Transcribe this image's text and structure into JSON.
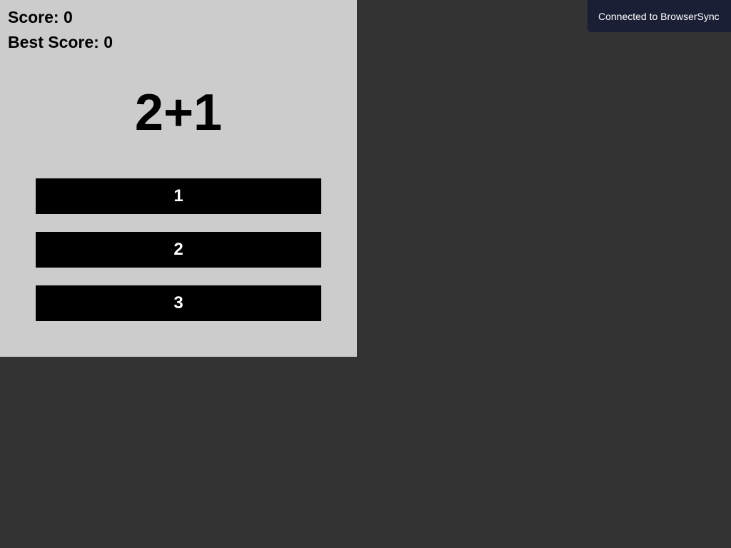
{
  "colors": {
    "page_background": "#333333",
    "panel_background": "#cccccc",
    "button_background": "#000000",
    "button_text": "#ffffff",
    "toast_background": "#1b1f36"
  },
  "game": {
    "score_label": "Score: 0",
    "best_score_label": "Best Score: 0",
    "question": "2+1",
    "answers": [
      {
        "label": "1"
      },
      {
        "label": "2"
      },
      {
        "label": "3"
      }
    ]
  },
  "notification": {
    "text": "Connected to BrowserSync"
  }
}
